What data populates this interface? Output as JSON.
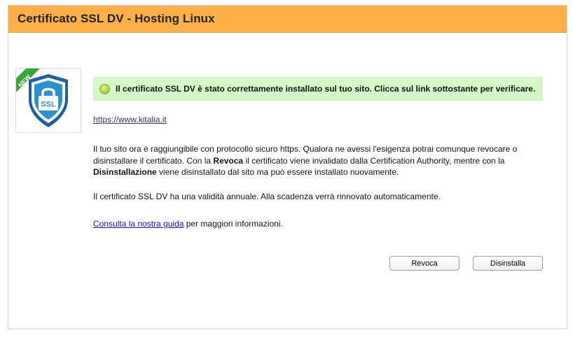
{
  "header": {
    "title": "Certificato SSL DV - Hosting Linux"
  },
  "logo": {
    "badge_text": "NEW",
    "shield_text": "SSL",
    "colors": {
      "badge": "#3aa53a",
      "shield": "#2e8fd0",
      "shield_dark": "#1f5f9f"
    }
  },
  "alert": {
    "icon": "success-dot-icon",
    "text": "Il certificato SSL DV è stato correttamente installato sul tuo sito. Clicca sul link sottostante per verificare.",
    "color": "#d3f9c7"
  },
  "site_link": "https://www.kitalia.it",
  "description": {
    "part1": "Il tuo sito ora è raggiungibile con protocollo sicuro https. Qualora ne avessi l'esigenza potrai comunque revocare o disinstallare il certificato. Con la ",
    "revoca_bold": "Revoca",
    "part2": " il certificato viene invalidato dalla Certification Authority, mentre con la ",
    "disinstallazione_bold": "Disinstallazione",
    "part3": " viene disinstallato dal sito ma può essere installato nuovamente."
  },
  "validity_text": "Il certificato SSL DV ha una validità annuale. Alla scadenza verrà rinnovato automaticamente.",
  "guide": {
    "link_text": "Consulta la nostra guida",
    "suffix": " per maggiori informazioni."
  },
  "buttons": {
    "revoca": "Revoca",
    "disinstalla": "Disinstalla"
  },
  "accent_color": "#fdb049"
}
